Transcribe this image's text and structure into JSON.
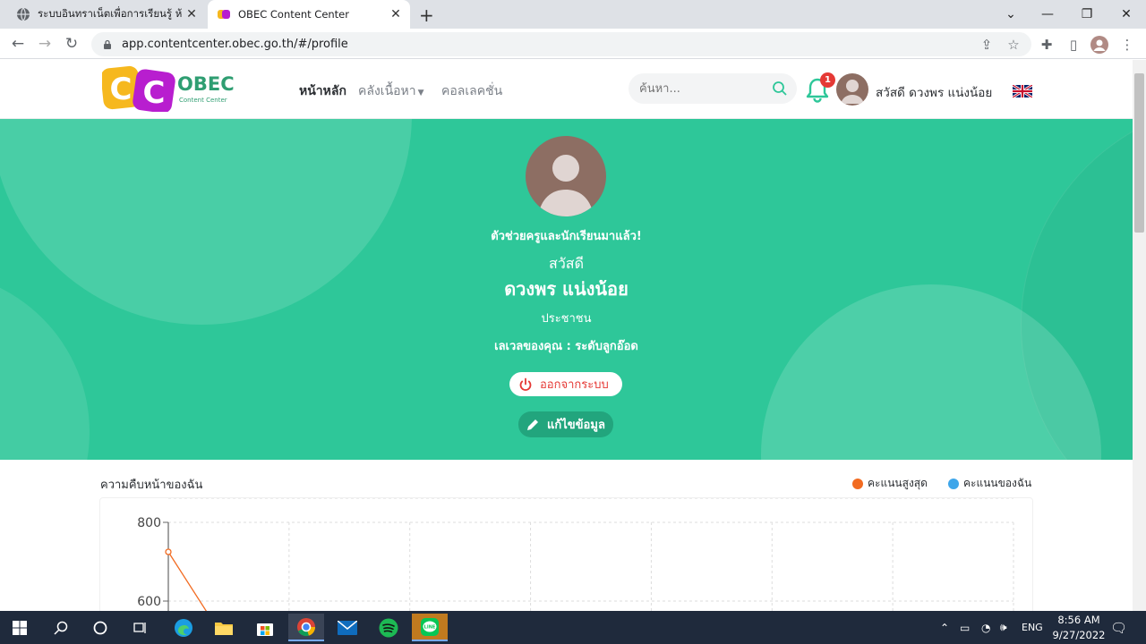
{
  "browser": {
    "tabs": [
      {
        "title": "ระบบอินทราเน็ตเพื่อการเรียนรู้ ห้องเรียน",
        "active": false
      },
      {
        "title": "OBEC Content Center",
        "active": true
      }
    ],
    "url": "app.contentcenter.obec.go.th/#/profile"
  },
  "header": {
    "logo_text": "OBEC",
    "logo_sub": "Content Center",
    "nav": [
      {
        "label": "หน้าหลัก",
        "active": true
      },
      {
        "label": "คลังเนื้อหา",
        "dropdown": true
      },
      {
        "label": "คอลเลคชั่น"
      }
    ],
    "search_placeholder": "ค้นหา...",
    "notification_count": "1",
    "greeting": "สวัสดี ดวงพร แน่งน้อย",
    "language_flag": "uk-flag"
  },
  "profile": {
    "tagline": "ตัวช่วยครูและนักเรียนมาแล้ว!",
    "hello": "สวัสดี",
    "name": "ดวงพร แน่งน้อย",
    "role": "ประชาชน",
    "level": "เลเวลของคุณ : ระดับลูกอ๊อด",
    "logout_label": "ออกจากระบบ",
    "edit_label": "แก้ไขข้อมูล"
  },
  "progress": {
    "title": "ความคืบหน้าของฉัน",
    "legend": [
      {
        "label": "คะแนนสูงสุด",
        "color": "#f26b21"
      },
      {
        "label": "คะแนนของฉัน",
        "color": "#3ea6ea"
      }
    ]
  },
  "chart_data": {
    "type": "line",
    "y_ticks": [
      "800",
      "600"
    ],
    "series": [
      {
        "name": "คะแนนสูงสุด",
        "color": "#f26b21",
        "values": [
          725
        ]
      },
      {
        "name": "คะแนนของฉัน",
        "color": "#3ea6ea",
        "values": []
      }
    ]
  },
  "taskbar": {
    "language": "ENG",
    "time": "8:56 AM",
    "date": "9/27/2022"
  },
  "colors": {
    "hero": "#2ec799",
    "accent_red": "#e53935",
    "brand_green": "#22a57d"
  }
}
